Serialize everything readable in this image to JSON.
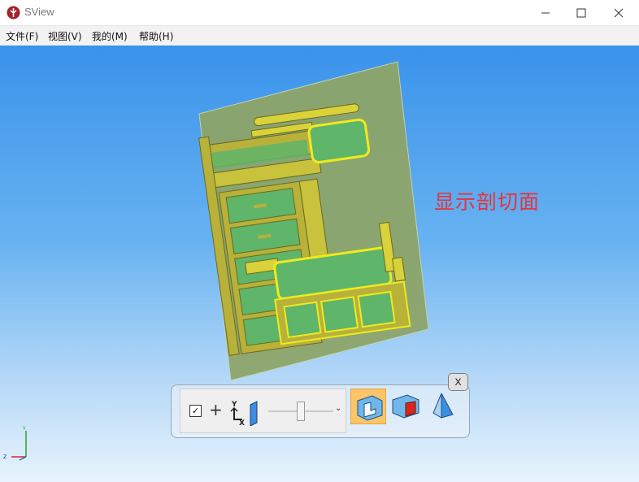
{
  "window": {
    "title": "SView",
    "minimize": "—",
    "maximize": "☐",
    "close": "✕"
  },
  "menu": [
    {
      "label": "文件(F)"
    },
    {
      "label": "视图(V)"
    },
    {
      "label": "我的(M)"
    },
    {
      "label": "帮助(H)"
    }
  ],
  "viewport": {
    "section_label": "显示剖切面",
    "section_label_color": "#e8333a"
  },
  "toolbar": {
    "checkbox_checked": true,
    "checkbox_glyph": "✓",
    "plus_glyph": "+",
    "axis_y": "Y",
    "axis_x": "X",
    "dropdown_glyph": "⌄",
    "slider_value": 0.5,
    "close_label": "X"
  },
  "triad": {
    "axis_y": "Y",
    "axis_z": "Z"
  },
  "colors": {
    "model_yellow": "#f0ea1e",
    "model_olive": "#b8b13a",
    "model_green": "#5fb56a",
    "plane": "#8ea56a",
    "active_tool": "#fbc56a"
  }
}
